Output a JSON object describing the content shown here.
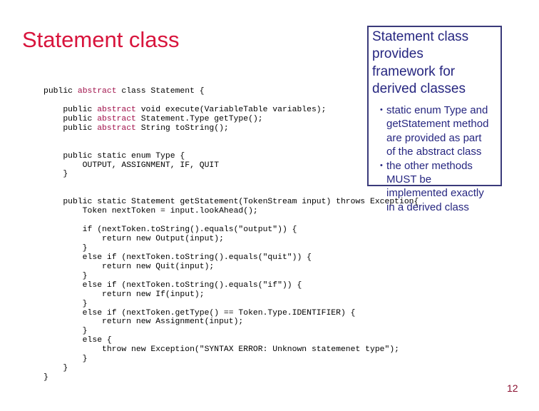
{
  "slide": {
    "title": "Statement class",
    "page_number": "12",
    "colors": {
      "title": "#d8143c",
      "keyword": "#a0104a",
      "callout_text": "#262680",
      "callout_border": "#3a3a7a"
    }
  },
  "callout": {
    "heading": [
      "Statement class",
      "provides",
      "framework for",
      "derived classes"
    ],
    "bullet_glyph": "•",
    "bullets": [
      [
        "static enum Type and",
        "getStatement method",
        "are provided as part",
        "of the abstract class"
      ],
      [
        "the other methods",
        "MUST be",
        "implemented exactly",
        "in a derived class"
      ]
    ]
  },
  "code": {
    "lines": [
      {
        "indent": "",
        "pre": "public ",
        "kw": "abstract",
        "post": " class Statement {"
      },
      {
        "indent": "",
        "pre": "",
        "kw": "",
        "post": ""
      },
      {
        "indent": "    ",
        "pre": "public ",
        "kw": "abstract",
        "post": " void execute(VariableTable variables);"
      },
      {
        "indent": "    ",
        "pre": "public ",
        "kw": "abstract",
        "post": " Statement.Type getType();"
      },
      {
        "indent": "    ",
        "pre": "public ",
        "kw": "abstract",
        "post": " String toString();"
      },
      {
        "indent": "",
        "pre": "",
        "kw": "",
        "post": ""
      },
      {
        "indent": "",
        "pre": "",
        "kw": "",
        "post": ""
      },
      {
        "indent": "    ",
        "pre": "public static enum Type {",
        "kw": "",
        "post": ""
      },
      {
        "indent": "        ",
        "pre": "OUTPUT, ASSIGNMENT, IF, QUIT",
        "kw": "",
        "post": ""
      },
      {
        "indent": "    ",
        "pre": "}",
        "kw": "",
        "post": ""
      },
      {
        "indent": "",
        "pre": "",
        "kw": "",
        "post": ""
      },
      {
        "indent": "",
        "pre": "",
        "kw": "",
        "post": ""
      },
      {
        "indent": "    ",
        "pre": "public static Statement getStatement(TokenStream input) throws Exception{",
        "kw": "",
        "post": ""
      },
      {
        "indent": "        ",
        "pre": "Token nextToken = input.lookAhead();",
        "kw": "",
        "post": ""
      },
      {
        "indent": "",
        "pre": "",
        "kw": "",
        "post": ""
      },
      {
        "indent": "        ",
        "pre": "if (nextToken.toString().equals(\"output\")) {",
        "kw": "",
        "post": ""
      },
      {
        "indent": "            ",
        "pre": "return new Output(input);",
        "kw": "",
        "post": ""
      },
      {
        "indent": "        ",
        "pre": "}",
        "kw": "",
        "post": ""
      },
      {
        "indent": "        ",
        "pre": "else if (nextToken.toString().equals(\"quit\")) {",
        "kw": "",
        "post": ""
      },
      {
        "indent": "            ",
        "pre": "return new Quit(input);",
        "kw": "",
        "post": ""
      },
      {
        "indent": "        ",
        "pre": "}",
        "kw": "",
        "post": ""
      },
      {
        "indent": "        ",
        "pre": "else if (nextToken.toString().equals(\"if\")) {",
        "kw": "",
        "post": ""
      },
      {
        "indent": "            ",
        "pre": "return new If(input);",
        "kw": "",
        "post": ""
      },
      {
        "indent": "        ",
        "pre": "}",
        "kw": "",
        "post": ""
      },
      {
        "indent": "        ",
        "pre": "else if (nextToken.getType() == Token.Type.IDENTIFIER) {",
        "kw": "",
        "post": ""
      },
      {
        "indent": "            ",
        "pre": "return new Assignment(input);",
        "kw": "",
        "post": ""
      },
      {
        "indent": "        ",
        "pre": "}",
        "kw": "",
        "post": ""
      },
      {
        "indent": "        ",
        "pre": "else {",
        "kw": "",
        "post": ""
      },
      {
        "indent": "            ",
        "pre": "throw new Exception(\"SYNTAX ERROR: Unknown statemenet type\");",
        "kw": "",
        "post": ""
      },
      {
        "indent": "        ",
        "pre": "}",
        "kw": "",
        "post": ""
      },
      {
        "indent": "    ",
        "pre": "}",
        "kw": "",
        "post": ""
      },
      {
        "indent": "",
        "pre": "}",
        "kw": "",
        "post": ""
      }
    ]
  }
}
